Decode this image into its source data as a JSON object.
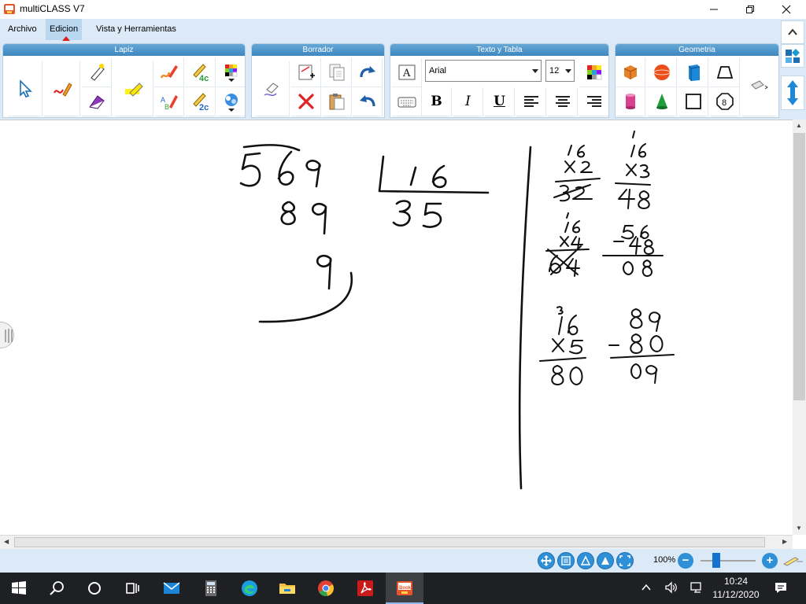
{
  "window": {
    "title": "multiCLASS V7",
    "logo_icon": "multiclass-logo-icon",
    "controls": [
      "minimize-icon",
      "maximize-icon",
      "close-icon"
    ]
  },
  "menu": {
    "items": [
      {
        "label": "Archivo"
      },
      {
        "label": "Edicion",
        "selected": true
      },
      {
        "label": "Vista y Herramientas"
      }
    ]
  },
  "ribbon": {
    "groups": [
      {
        "title": "Lapiz",
        "tools": [
          "pointer-icon",
          "pen-icon",
          "highlighter-icon",
          "marker-icon",
          "eraser-shape-icon",
          "color-pen-icon",
          "text-pen-icon",
          "fraction-4c-icon",
          "fraction-2c-icon",
          "color-palette-icon",
          "fill-cloud-icon"
        ],
        "labels": {
          "fraction_4c": "4c",
          "fraction_2c": "2c"
        }
      },
      {
        "title": "Borrador",
        "tools": [
          "eraser-icon",
          "new-page-icon",
          "copy-icon",
          "redo-icon",
          "delete-icon",
          "paste-icon",
          "undo-icon"
        ]
      },
      {
        "title": "Texto y Tabla",
        "font_family": "Arial",
        "font_size": "12",
        "tools": [
          "text-box-icon",
          "color-grid-icon",
          "keyboard-icon",
          "bold-icon",
          "italic-icon",
          "underline-icon",
          "align-left-icon",
          "align-center-icon",
          "align-right-icon"
        ],
        "labels": {
          "text_box": "A",
          "bold": "B",
          "italic": "I",
          "underline": "U"
        }
      },
      {
        "title": "Geometria",
        "tools": [
          "cube-icon",
          "sphere-icon",
          "prism-icon",
          "trapezoid-icon",
          "cylinder-icon",
          "cone-icon",
          "square-icon",
          "octagon-icon",
          "ruler-icon"
        ],
        "labels": {
          "octagon": "8"
        }
      }
    ]
  },
  "right_rail": [
    "chevron-up-icon",
    "layout-icon",
    "vertical-resize-icon"
  ],
  "workspace": {
    "division": {
      "dividend": "569",
      "divisor": "16",
      "quotient": "35",
      "partial": "89",
      "remainder": "9"
    },
    "side_calculations": [
      {
        "top": "16",
        "multiplier": "x2",
        "result": "32",
        "crossed_out": true
      },
      {
        "top": "16",
        "multiplier": "x3",
        "result": "48",
        "carry": "1"
      },
      {
        "top": "16",
        "multiplier": "x4",
        "result": "64",
        "crossed_out": true,
        "carry": "2"
      },
      {
        "minuend": "56",
        "subtrahend": "-48",
        "difference": "08"
      },
      {
        "top": "16",
        "multiplier": "x5",
        "result": "80",
        "carry": "3"
      },
      {
        "minuend": "89",
        "subtrahend": "-80",
        "difference": "09"
      }
    ]
  },
  "bottom_bar": {
    "nav_icons": [
      "move-icon",
      "page-list-icon",
      "prev-page-icon",
      "next-page-icon",
      "fit-screen-icon"
    ],
    "zoom_label": "100%",
    "zoom_level": 1.0
  },
  "taskbar": {
    "items": [
      "windows-start-icon",
      "search-icon",
      "cortana-icon",
      "task-view-icon",
      "mail-icon",
      "calculator-icon",
      "edge-icon",
      "file-explorer-icon",
      "chrome-icon",
      "acrobat-icon",
      "multiclass-taskbar-icon"
    ],
    "active_item_label": "Book",
    "tray": [
      "chevron-up-icon",
      "volume-icon",
      "network-icon",
      "notification-icon"
    ],
    "time": "10:24",
    "date": "11/12/2020"
  }
}
